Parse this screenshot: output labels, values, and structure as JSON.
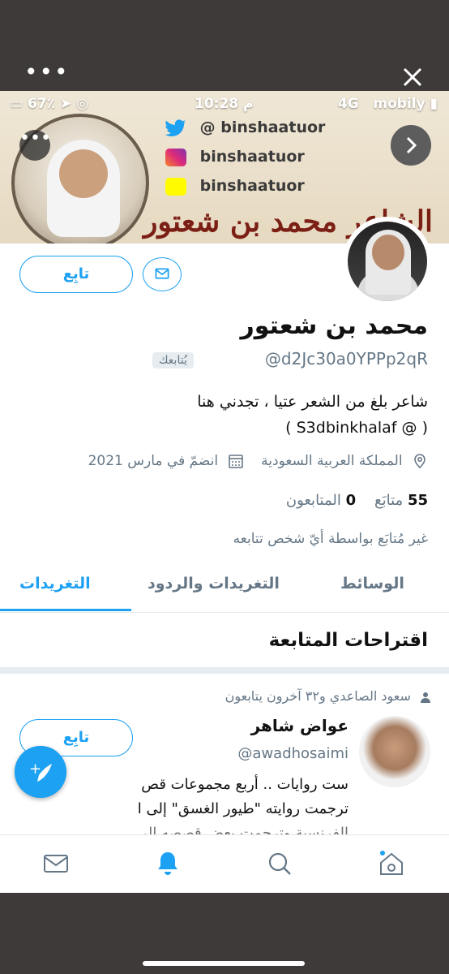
{
  "status_bar": {
    "battery": "67٪",
    "time": "10:28 م",
    "network": "4G",
    "carrier": "mobily"
  },
  "banner": {
    "twitter": "@ binshaatuor",
    "instagram": "binshaatuor",
    "snapchat": "binshaatuor",
    "title": "الشاعر محمد بن شعتور"
  },
  "profile": {
    "follow_label": "تابِع",
    "name": "محمد بن شعتور",
    "handle": "@d2Jc30a0YPPp2qR",
    "follows_you": "يُتابعك",
    "bio_line1": "شاعر بلغ من الشعر عتيا ، تجدني هنا",
    "bio_line2": "( @ S3dbinkhalaf )",
    "location": "المملكة العربية السعودية",
    "joined": "انضمّ في مارس 2021",
    "following_count": "55",
    "following_label": "متابَع",
    "followers_count": "0",
    "followers_label": "المتابعون",
    "not_followed_note": "غير مُتابَع بواسطة أيّ شخص تتابعه"
  },
  "tabs": [
    {
      "label": "التغريدات",
      "active": true
    },
    {
      "label": "التغريدات والردود",
      "active": false
    },
    {
      "label": "الوسائط",
      "active": false
    }
  ],
  "suggestions": {
    "title": "اقتراحات المتابعة",
    "context": "سعود الصاعدي و٣٢ آخرون يتابعون",
    "name": "عواض شاهر",
    "handle": "@awadhosaimi",
    "follow_label": "تابِع",
    "desc_line1": "ست روايات .. أربع مجموعات قص",
    "desc_line2": "ترجمت روايته \"طيور الغسق\" إلى ا",
    "desc_line3": "الفرنسية وترجمت بعض قصصه إلى"
  },
  "bottom_nav": [
    "mail-icon",
    "bell-icon",
    "search-icon",
    "home-icon"
  ],
  "colors": {
    "accent": "#1da1f2",
    "text": "#111111",
    "muted": "#657786"
  }
}
